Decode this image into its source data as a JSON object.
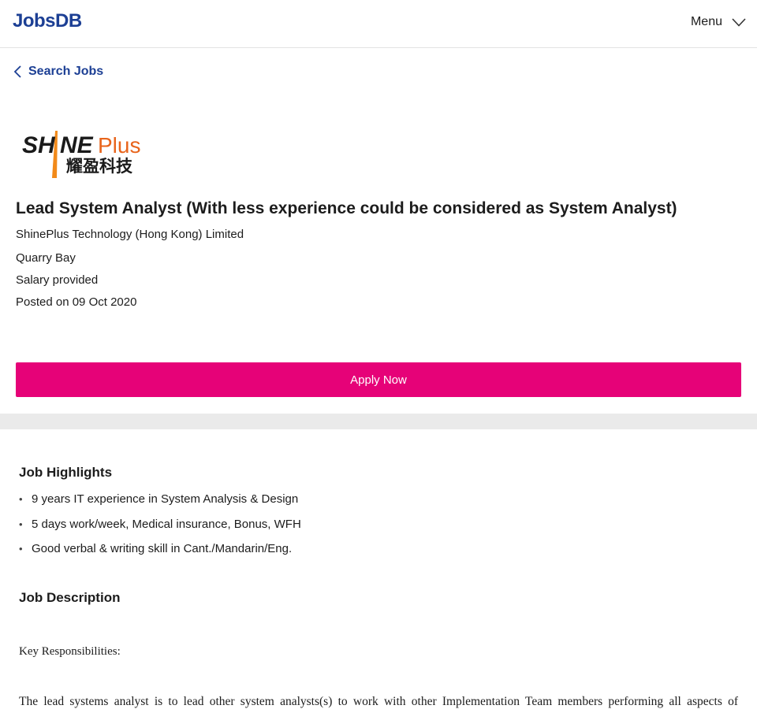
{
  "header": {
    "logo_text": "JobsDB",
    "menu_label": "Menu",
    "brand_color": "#1c3f94"
  },
  "nav": {
    "back_label": "Search Jobs"
  },
  "job": {
    "company_logo_text": "SHINEPlus",
    "company_logo_chinese": "耀盈科技",
    "title": "Lead System Analyst (With less experience could be considered as System Analyst)",
    "company": "ShinePlus Technology (Hong Kong) Limited",
    "location": "Quarry Bay",
    "salary": "Salary provided",
    "posted": "Posted on 09 Oct 2020",
    "apply_label": "Apply Now",
    "apply_color": "#e60278"
  },
  "highlights": {
    "title": "Job Highlights",
    "items": [
      "9 years IT experience in System Analysis & Design",
      "5 days work/week, Medical insurance, Bonus, WFH",
      "Good verbal & writing skill in Cant./Mandarin/Eng."
    ]
  },
  "description": {
    "title": "Job Description",
    "key_responsibilities": "Key Responsibilities:",
    "paragraph_start": "The lead systems analyst is to lead other system analysts(s) to work with other Implementation Team members performing all aspects of"
  }
}
